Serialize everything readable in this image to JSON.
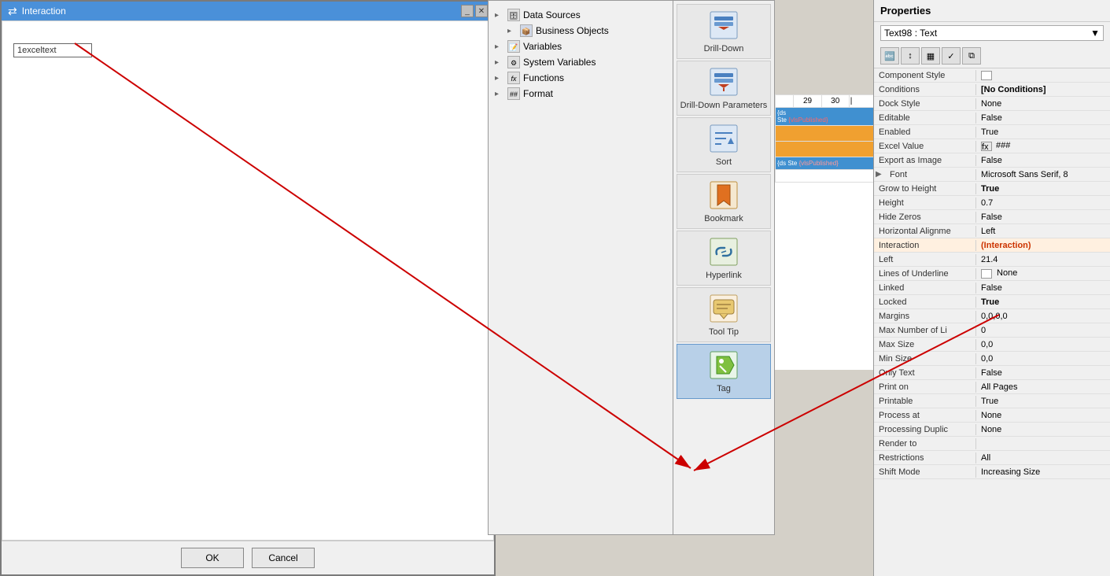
{
  "window": {
    "title": "Interaction",
    "close_label": "✕"
  },
  "dialog": {
    "excel_text": "1exceltext"
  },
  "tree": {
    "items": [
      {
        "label": "Data Sources",
        "icon": "🗄",
        "expanded": true,
        "indent": 0
      },
      {
        "label": "Business Objects",
        "icon": "📦",
        "expanded": false,
        "indent": 1
      },
      {
        "label": "Variables",
        "icon": "📝",
        "expanded": false,
        "indent": 0
      },
      {
        "label": "System Variables",
        "icon": "⚙",
        "expanded": false,
        "indent": 0
      },
      {
        "label": "Functions",
        "icon": "fx",
        "expanded": false,
        "indent": 0
      },
      {
        "label": "Format",
        "icon": "##",
        "expanded": false,
        "indent": 0
      }
    ]
  },
  "actions": [
    {
      "id": "drill-down",
      "label": "Drill-Down",
      "icon": "⬇"
    },
    {
      "id": "drill-down-params",
      "label": "Drill-Down Parameters",
      "icon": "⬇"
    },
    {
      "id": "sort",
      "label": "Sort",
      "icon": "↕"
    },
    {
      "id": "bookmark",
      "label": "Bookmark",
      "icon": "🔖"
    },
    {
      "id": "hyperlink",
      "label": "Hyperlink",
      "icon": "🔗"
    },
    {
      "id": "tooltip",
      "label": "Tool Tip",
      "icon": "💬"
    },
    {
      "id": "tag",
      "label": "Tag",
      "icon": "🏷",
      "selected": true
    }
  ],
  "buttons": {
    "ok": "OK",
    "cancel": "Cancel"
  },
  "properties": {
    "title": "Properties",
    "component_label": "Text98 : Text",
    "rows": [
      {
        "name": "Component Style",
        "value": "",
        "has_color_box": true,
        "bold": false
      },
      {
        "name": "Conditions",
        "value": "[No Conditions]",
        "bold": true
      },
      {
        "name": "Dock Style",
        "value": "None",
        "bold": false
      },
      {
        "name": "Editable",
        "value": "False",
        "bold": false
      },
      {
        "name": "Enabled",
        "value": "True",
        "bold": false
      },
      {
        "name": "Excel Value",
        "value": "###",
        "bold": false,
        "has_icon": true
      },
      {
        "name": "Export as Image",
        "value": "False",
        "bold": false
      },
      {
        "name": "Font",
        "value": "Microsoft Sans Serif, 8",
        "bold": false,
        "has_expand": true
      },
      {
        "name": "Grow to Height",
        "value": "True",
        "bold": true
      },
      {
        "name": "Height",
        "value": "0.7",
        "bold": false
      },
      {
        "name": "Hide Zeros",
        "value": "False",
        "bold": false
      },
      {
        "name": "Horizontal Alignme",
        "value": "Left",
        "bold": false
      },
      {
        "name": "Interaction",
        "value": "(Interaction)",
        "bold": true,
        "highlight": true
      },
      {
        "name": "Left",
        "value": "21.4",
        "bold": false
      },
      {
        "name": "Lines of Underline",
        "value": "None",
        "bold": false,
        "has_color_box": true
      },
      {
        "name": "Linked",
        "value": "False",
        "bold": false
      },
      {
        "name": "Locked",
        "value": "True",
        "bold": true
      },
      {
        "name": "Margins",
        "value": "0,0,0,0",
        "bold": false
      },
      {
        "name": "Max Number of Li",
        "value": "0",
        "bold": false
      },
      {
        "name": "Max Size",
        "value": "0,0",
        "bold": false
      },
      {
        "name": "Min Size",
        "value": "0,0",
        "bold": false
      },
      {
        "name": "Only Text",
        "value": "False",
        "bold": false
      },
      {
        "name": "Print on",
        "value": "All Pages",
        "bold": false
      },
      {
        "name": "Printable",
        "value": "True",
        "bold": false
      },
      {
        "name": "Process at",
        "value": "None",
        "bold": false
      },
      {
        "name": "Processing Duplic",
        "value": "None",
        "bold": false
      },
      {
        "name": "Render to",
        "value": "",
        "bold": false
      },
      {
        "name": "Restrictions",
        "value": "All",
        "bold": false
      },
      {
        "name": "Shift Mode",
        "value": "Increasing Size",
        "bold": false
      }
    ],
    "toolbar_buttons": [
      "sort-az",
      "properties",
      "square",
      "check",
      "copy"
    ]
  }
}
